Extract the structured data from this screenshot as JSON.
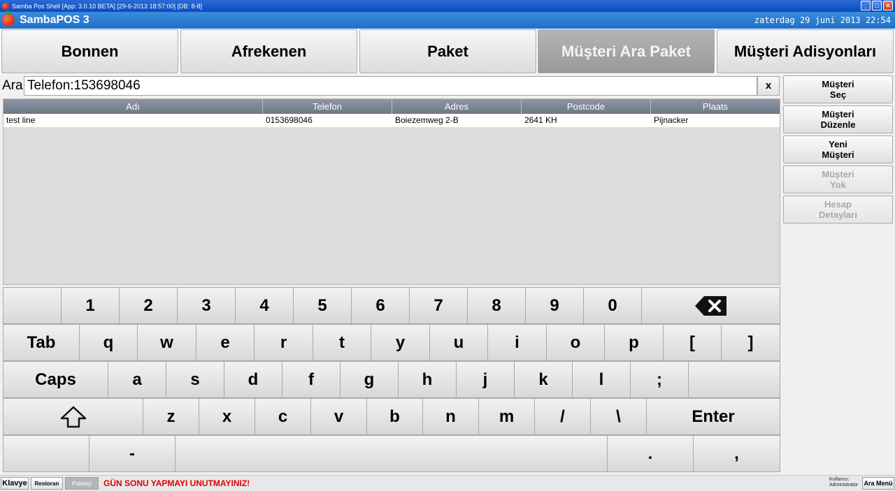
{
  "window": {
    "title": "Samba Pos Shell [App: 3.0.10 BETA] [29-6-2013 18:57:00] [DB: 8-8]",
    "min_label": "_",
    "max_label": "□",
    "close_label": "×"
  },
  "header": {
    "app_name": "SambaPOS 3",
    "date": "zaterdag 29 juni 2013 22:54"
  },
  "tabs": [
    {
      "label": "Bonnen"
    },
    {
      "label": "Afrekenen"
    },
    {
      "label": "Paket"
    },
    {
      "label": "Müşteri Ara Paket",
      "active": true
    },
    {
      "label": "Müşteri Adisyonları"
    }
  ],
  "search": {
    "label": "Ara",
    "value": "Telefon:153698046",
    "clear_label": "x"
  },
  "table": {
    "columns": [
      "Adı",
      "Telefon",
      "Adres",
      "Postcode",
      "Plaats"
    ],
    "rows": [
      [
        "test line",
        "0153698046",
        "Boiezemweg 2-B",
        "2641 KH",
        "Pijnacker"
      ]
    ]
  },
  "side_buttons": [
    {
      "label": "Müşteri\nSeç",
      "enabled": true
    },
    {
      "label": "Müşteri\nDüzenle",
      "enabled": true
    },
    {
      "label": "Yeni\nMüşteri",
      "enabled": true
    },
    {
      "label": "Müşteri\nYok",
      "enabled": false
    },
    {
      "label": "Hesap\nDetayları",
      "enabled": false
    }
  ],
  "keyboard": {
    "row1": [
      "",
      "1",
      "2",
      "3",
      "4",
      "5",
      "6",
      "7",
      "8",
      "9",
      "0",
      "backspace"
    ],
    "row2": [
      "Tab",
      "q",
      "w",
      "e",
      "r",
      "t",
      "y",
      "u",
      "i",
      "o",
      "p",
      "[",
      "]"
    ],
    "row3": [
      "Caps",
      "a",
      "s",
      "d",
      "f",
      "g",
      "h",
      "j",
      "k",
      "l",
      ";",
      ""
    ],
    "row4": [
      "shift",
      "z",
      "x",
      "c",
      "v",
      "b",
      "n",
      "m",
      "/",
      "\\",
      "Enter"
    ],
    "row5": [
      "",
      "-",
      "",
      ".",
      ","
    ]
  },
  "statusbar": {
    "klavye": "Klavye",
    "restoran": "Restoran",
    "paketci": "Paketçi",
    "warning": "GÜN SONU YAPMAYI UNUTMAYINIZ!",
    "user_caption": "Kullanıcı:",
    "user_name": "Administrator",
    "menu": "Ara Menü"
  },
  "colors": {
    "title_blue": "#0a4ac0",
    "header_blue": "#1f6fc8",
    "warning_red": "#e00000",
    "grid_header": "#6d7785"
  }
}
